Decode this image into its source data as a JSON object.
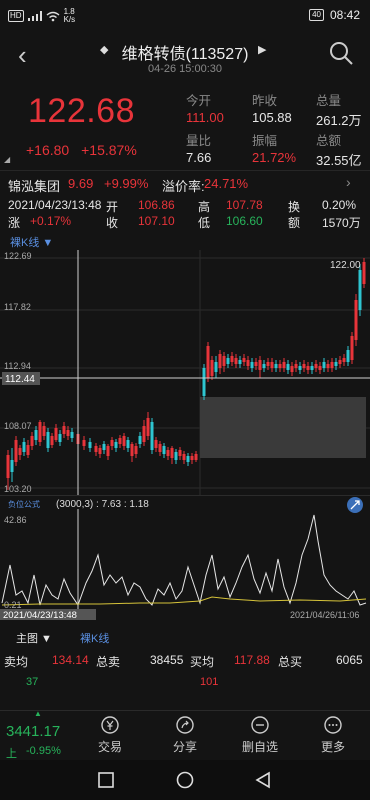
{
  "status": {
    "time": "08:42",
    "battery": "40",
    "net_speed": "1.8\nK/s",
    "hd": "HD"
  },
  "header": {
    "title": "维格转债(113527)",
    "subtitle": "04-26 15:00:30"
  },
  "quote": {
    "price": "122.68",
    "change_abs": "+16.80",
    "change_pct": "+15.87%",
    "stats": [
      {
        "label": "今开",
        "value": "111.00",
        "color": "#e8343a"
      },
      {
        "label": "昨收",
        "value": "105.88",
        "color": "#e6e6e6"
      },
      {
        "label": "总量",
        "value": "261.2万",
        "color": "#e6e6e6"
      },
      {
        "label": "量比",
        "value": "7.66",
        "color": "#e6e6e6"
      },
      {
        "label": "振幅",
        "value": "21.72%",
        "color": "#e8343a"
      },
      {
        "label": "总额",
        "value": "32.55亿",
        "color": "#e6e6e6"
      }
    ]
  },
  "reference": {
    "stock_name": "锦泓集团",
    "stock_price": "9.69",
    "stock_change": "+9.99%",
    "premium_label": "溢价率:",
    "premium_value": "24.71%"
  },
  "detail": {
    "date": "2021/04/23/13:48",
    "row1": {
      "l1": "开",
      "v1": "106.86",
      "l2": "高",
      "v2": "107.78",
      "l3": "换",
      "v3": "0.20%"
    },
    "row2": {
      "l0": "涨",
      "v0": "+0.17%",
      "l1": "收",
      "v1": "107.10",
      "l2": "低",
      "v2": "106.60",
      "l3": "额",
      "v3": "1570万"
    }
  },
  "kline_tab": "裸K线 ▼",
  "chart_axis": {
    "y_top": "122.69",
    "y_2": "117.82",
    "y_3": "112.94",
    "y_4": "108.07",
    "y_bottom": "103.20",
    "cursor_price": "112.44",
    "high_label": "122.00"
  },
  "osc": {
    "label": "负位公式",
    "params": "(3000,3) : 7.63 : 1.18",
    "y_top": "42.86",
    "y_bottom": "0.21",
    "x_left": "2021/04/23/13:48",
    "x_right": "2021/04/26/11:06"
  },
  "bottom_tabs": {
    "tab1": "主图 ▼",
    "tab2": "裸K线"
  },
  "summary": {
    "sell_avg_label": "卖均",
    "sell_avg": "134.14",
    "total_sell_label": "总卖",
    "total_sell": "38455",
    "buy_avg_label": "买均",
    "buy_avg": "117.88",
    "total_buy_label": "总买",
    "total_buy": "6065",
    "n1": "37",
    "n2": "101"
  },
  "footer": {
    "index_value": "3441.17",
    "index_name": "上",
    "index_change": "-0.95%",
    "btn_trade": "交易",
    "btn_share": "分享",
    "btn_remove": "删自选",
    "btn_more": "更多"
  }
}
